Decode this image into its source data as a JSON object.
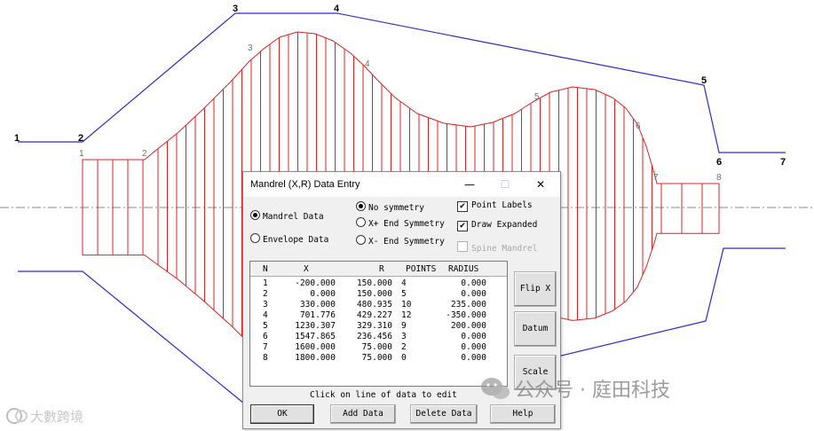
{
  "drawing": {
    "envelope_labels": [
      "1",
      "2",
      "3",
      "4",
      "5",
      "6",
      "7"
    ],
    "mandrel_labels": [
      "1",
      "2",
      "3",
      "4",
      "5",
      "6",
      "7",
      "8"
    ],
    "colors": {
      "envelope": "#2b2bd0",
      "mandrel": "#e02020",
      "axis": "#8a8a8a"
    }
  },
  "dialog": {
    "title": "Mandrel (X,R) Data Entry",
    "window_buttons": [
      "—",
      "☐",
      "✕"
    ],
    "mandrel_radio": "Mandrel Data",
    "envelope_radio": "Envelope Data",
    "sym_none": "No symmetry",
    "sym_xplus": "X+ End Symmetry",
    "sym_xminus": "X- End Symmetry",
    "point_labels": "Point Labels",
    "draw_expanded": "Draw Expanded",
    "spine_mandrel": "Spine Mandrel",
    "check_mark": "✔",
    "columns": [
      "N",
      "X",
      "R",
      "POINTS",
      "RADIUS"
    ],
    "rows": [
      {
        "n": "1",
        "x": "-200.000",
        "r": "150.000",
        "points": "4",
        "radius": "0.000"
      },
      {
        "n": "2",
        "x": "0.000",
        "r": "150.000",
        "points": "5",
        "radius": "0.000"
      },
      {
        "n": "3",
        "x": "330.000",
        "r": "480.935",
        "points": "10",
        "radius": "235.000"
      },
      {
        "n": "4",
        "x": "701.776",
        "r": "429.227",
        "points": "12",
        "radius": "-350.000"
      },
      {
        "n": "5",
        "x": "1230.307",
        "r": "329.310",
        "points": "9",
        "radius": "200.000"
      },
      {
        "n": "6",
        "x": "1547.865",
        "r": "236.456",
        "points": "3",
        "radius": "0.000"
      },
      {
        "n": "7",
        "x": "1600.000",
        "r": "75.000",
        "points": "2",
        "radius": "0.000"
      },
      {
        "n": "8",
        "x": "1800.000",
        "r": "75.000",
        "points": "0",
        "radius": "0.000"
      }
    ],
    "flip_x": "Flip X",
    "datum": "Datum",
    "scale": "Scale",
    "hint": "Click on line of data to edit",
    "ok": "OK",
    "add_data": "Add Data",
    "delete_data": "Delete Data",
    "help": "Help"
  },
  "watermark": {
    "right_text": "公众号 · 庭田科技",
    "left_text": "大數跨境"
  }
}
